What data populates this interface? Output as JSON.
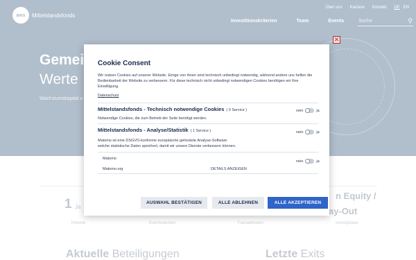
{
  "header": {
    "logo_badge": "aws",
    "logo_text": "Mittelstandsfonds",
    "top_links": [
      "Über uns",
      "Karriere",
      "Kontakt"
    ],
    "languages": [
      "DE",
      "EN"
    ],
    "active_language": "DE",
    "main_nav": [
      "Investitionskriterien",
      "Team",
      "Events"
    ],
    "search_placeholder": "Suche"
  },
  "hero": {
    "title_line1": "Gemei",
    "title_line2": "Werte",
    "subtitle": "Wachstumskapital u",
    "right_line1": "n Equity /",
    "right_line2": "ay-Out"
  },
  "stats": {
    "number": "1",
    "unit": "Ja",
    "labels": [
      "Historie",
      "Eventvolumen",
      "Transaktionen",
      "Investphase"
    ]
  },
  "sections": {
    "left_bold": "Aktuelle",
    "left_rest": " Beteiligungen",
    "right_bold": "Letzte",
    "right_rest": " Exits"
  },
  "cookie_modal": {
    "close_label": "✕",
    "title": "Cookie Consent",
    "intro": "Wir nutzen Cookies auf unserer Website. Einige von ihnen sind technisch unbedingt notwendig, während andere uns helfen die Bedienbarkeit der Website zu verbessern. Für diese technisch nicht unbedingt notwendigen Cookies benötigen wir Ihre Einwilligung.",
    "privacy_link": "Datenschutz",
    "technical": {
      "title": "Mittelstandsfonds - Technisch notwendige Cookies",
      "count": "( 0 Service )",
      "description": "Notwendige Cookies, die zum Betrieb der Seite benötigt werden.",
      "toggle_no": "nein",
      "toggle_yes": "ja"
    },
    "analytics": {
      "title": "Mittelstandsfonds - Analyse/Statistik",
      "count": "( 1 Service )",
      "description_line1": "Matomo ist eine DSGVO-konforme europäische gehostete Analyse-Software",
      "description_line2": "welche statistische Daten speichert, damit wir unsere Dienste verbessern können.",
      "toggle_no": "nein",
      "toggle_yes": "ja"
    },
    "matomo": {
      "name": "Matomo",
      "domain": "Matomo.org",
      "details": "DETAILS ANZEIGEN",
      "toggle_no": "nein",
      "toggle_yes": "ja"
    },
    "buttons": {
      "confirm_selection": "AUSWAHL BESTÄTIGEN",
      "reject_all": "ALLE ABLEHNEN",
      "accept_all": "ALLE AKZEPTIEREN"
    }
  },
  "colors": {
    "hero_bg": "#7d93ab",
    "accent": "#2f64c8",
    "title": "#1a2a4a"
  }
}
